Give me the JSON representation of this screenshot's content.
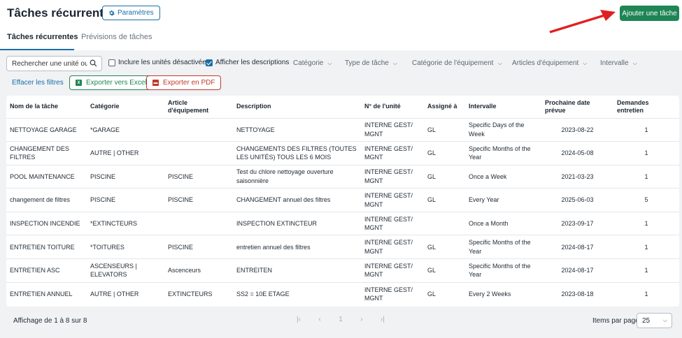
{
  "header": {
    "title": "Tâches récurrentes",
    "params_label": "Paramètres",
    "add_label": "Ajouter une tâche"
  },
  "tabs": [
    {
      "label": "Tâches récurrentes",
      "active": true
    },
    {
      "label": "Prévisions de tâches",
      "active": false
    }
  ],
  "filters": {
    "search_placeholder": "Rechercher une unité ou...",
    "include_inactive": {
      "label": "Inclure les unités désactivées",
      "checked": false
    },
    "show_descriptions": {
      "label": "Afficher les descriptions",
      "checked": true
    },
    "dropdowns": [
      "Catégorie",
      "Type de tâche",
      "Catégorie de l'équipement",
      "Articles d'équipement",
      "Intervalle"
    ],
    "clear_label": "Effacer les filtres",
    "export_excel": "Exporter vers Excel",
    "export_pdf": "Exporter en PDF"
  },
  "table": {
    "columns": [
      "Nom de la tâche",
      "Catégorie",
      "Article d'équipement",
      "Description",
      "N° de l'unité",
      "Assigné à",
      "Intervalle",
      "Prochaine date prévue",
      "Demandes entretien"
    ],
    "rows": [
      [
        "NETTOYAGE GARAGE",
        "*GARAGE",
        "",
        "NETTOYAGE",
        "INTERNE GEST/ MGNT",
        "GL",
        "Specific Days of the Week",
        "2023-08-22",
        "1"
      ],
      [
        "CHANGEMENT DES FILTRES",
        "AUTRE | OTHER",
        "",
        "CHANGEMENTS DES FILTRES (TOUTES LES UNITÉS) TOUS LES 6 MOIS",
        "INTERNE GEST/ MGNT",
        "GL",
        "Specific Months of the Year",
        "2024-05-08",
        "1"
      ],
      [
        "POOL MAINTENANCE",
        "PISCINE",
        "PISCINE",
        "Test du chlore nettoyage ouverture saisonnière",
        "INTERNE GEST/ MGNT",
        "GL",
        "Once a Week",
        "2021-03-23",
        "1"
      ],
      [
        "changement de filtres",
        "PISCINE",
        "PISCINE",
        "CHANGEMENT annuel des filtres",
        "INTERNE GEST/ MGNT",
        "GL",
        "Every Year",
        "2025-06-03",
        "5"
      ],
      [
        "INSPECTION INCENDIE",
        "*EXTINCTEURS",
        "",
        "INSPECTION EXTINCTEUR",
        "INTERNE GEST/ MGNT",
        "",
        "Once a Month",
        "2023-09-17",
        "1"
      ],
      [
        "ENTRETIEN TOITURE",
        "*TOITURES",
        "PISCINE",
        "entretien annuel des filtres",
        "INTERNE GEST/ MGNT",
        "GL",
        "Specific Months of the Year",
        "2024-08-17",
        "1"
      ],
      [
        "ENTRETIEN ASC",
        "ASCENSEURS | ELEVATORS",
        "Ascenceurs",
        "ENTREITEN",
        "INTERNE GEST/ MGNT",
        "GL",
        "Specific Months of the Year",
        "2024-08-17",
        "1"
      ],
      [
        "ENTRETIEN ANNUEL",
        "AUTRE | OTHER",
        "EXTINCTEURS",
        "SS2 = 10E ETAGE",
        "INTERNE GEST/ MGNT",
        "GL",
        "Every 2 Weeks",
        "2023-08-18",
        "1"
      ]
    ]
  },
  "footer": {
    "info": "Affichage de 1 à 8 sur 8",
    "pager": {
      "first": "|‹",
      "prev": "‹",
      "page": "1",
      "next": "›",
      "last": "›|"
    },
    "items_per_page_label": "Items par page",
    "items_per_page_value": "25"
  },
  "colors": {
    "primary": "#1b6ea8",
    "success": "#1e8554",
    "danger": "#c0392b",
    "annotation_arrow": "#e02020"
  }
}
